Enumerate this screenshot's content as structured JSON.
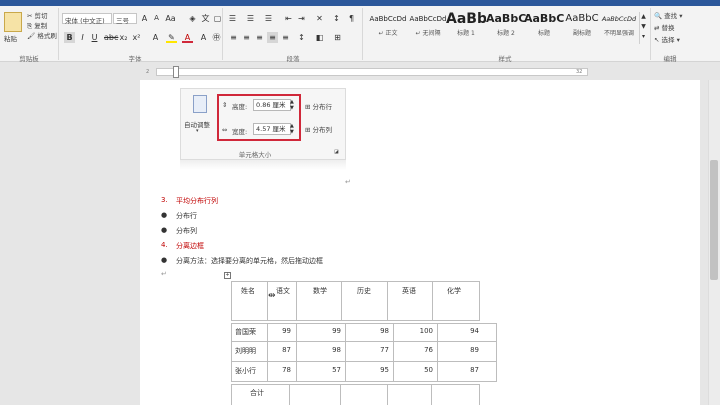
{
  "ribbon": {
    "clipboard": {
      "paste": "粘贴",
      "cut": "剪切",
      "copy": "复制",
      "format_painter": "格式刷",
      "group": "剪贴板"
    },
    "font": {
      "name": "宋体 (中文正)",
      "size": "三号",
      "group": "字体"
    },
    "paragraph": {
      "group": "段落"
    },
    "styles": {
      "group": "样式",
      "items": [
        {
          "preview": "AaBbCcDd",
          "name": "↵ 正文"
        },
        {
          "preview": "AaBbCcDd",
          "name": "↵ 无间隔"
        },
        {
          "preview": "AaBb",
          "name": "标题 1"
        },
        {
          "preview": "AaBbC",
          "name": "标题 2"
        },
        {
          "preview": "AaBbC",
          "name": "标题"
        },
        {
          "preview": "AaBbC",
          "name": "副标题"
        },
        {
          "preview": "AaBbCcDd",
          "name": "不明显强调"
        }
      ]
    },
    "editing": {
      "find": "查找",
      "replace": "替换",
      "select": "选择",
      "group": "编辑"
    }
  },
  "ruler": {
    "left_num": "2",
    "right_num": "32"
  },
  "cell_size_panel": {
    "auto_fit": "自动调整",
    "height_label": "高度:",
    "height_value": "0.86 厘米",
    "width_label": "宽度:",
    "width_value": "4.57 厘米",
    "distribute_rows": "分布行",
    "distribute_cols": "分布列",
    "group_label": "单元格大小"
  },
  "doc": {
    "lines": [
      {
        "num": "3.",
        "text": "平均分布行列",
        "style": "red"
      },
      {
        "num": "●",
        "text": "分布行",
        "style": "black"
      },
      {
        "num": "●",
        "text": "分布列",
        "style": "black"
      },
      {
        "num": "4.",
        "text": "分离边框",
        "style": "red"
      },
      {
        "num": "●",
        "text": "分离方法：选择要分离的单元格，然后拖动边框",
        "style": "black"
      }
    ]
  },
  "table": {
    "headers": [
      "姓名",
      "语文",
      "数学",
      "历史",
      "英语",
      "化学"
    ],
    "rows": [
      {
        "name": "曾国荣",
        "values": [
          "99",
          "99",
          "98",
          "100",
          "94"
        ]
      },
      {
        "name": "刘明明",
        "values": [
          "87",
          "98",
          "77",
          "76",
          "89"
        ]
      },
      {
        "name": "张小行",
        "values": [
          "78",
          "57",
          "95",
          "50",
          "87"
        ]
      }
    ],
    "total_label": "合计"
  }
}
